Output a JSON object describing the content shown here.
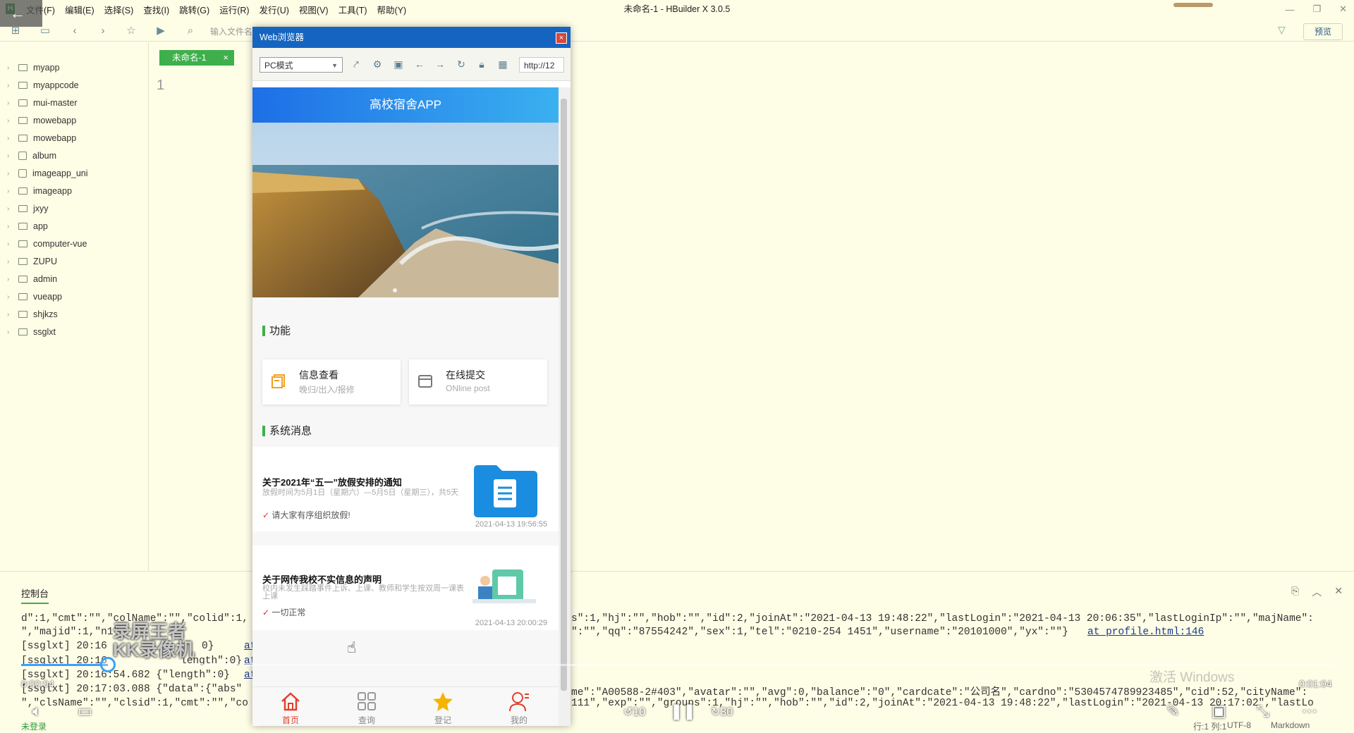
{
  "app": {
    "title": "未命名-1 - HBuilder X 3.0.5",
    "menu": [
      "文件(F)",
      "编辑(E)",
      "选择(S)",
      "查找(I)",
      "跳转(G)",
      "运行(R)",
      "发行(U)",
      "视图(V)",
      "工具(T)",
      "帮助(Y)"
    ],
    "logo_letter": "H",
    "back_arrow": "←"
  },
  "toolbar": {
    "file_input_placeholder": "输入文件名",
    "preview_label": "预览"
  },
  "sidebar": {
    "projects": [
      "myapp",
      "myappcode",
      "mui-master",
      "mowebapp",
      "mowebapp",
      "album",
      "imageapp_uni",
      "imageapp",
      "jxyy",
      "app",
      "computer-vue",
      "ZUPU",
      "admin",
      "vueapp",
      "shjkzs",
      "ssglxt"
    ]
  },
  "editor": {
    "tab_label": "未命名-1",
    "tab_close": "×",
    "line_number": "1"
  },
  "console": {
    "tab_label": "控制台",
    "lines": [
      "d\":1,\"cmt\":\"\",\"colName\":\"\",\"colid\":1,",
      "\",\"majid\":1,\"n1\"",
      "[ssglxt] 20:16",
      "[ssglxt] 20:16",
      "[ssglxt] 20:16:54.682 {\"length\":0}",
      "[ssglxt] 20:17:03.088 {\"data\":{\"abs\"",
      "\",\"clsName\":\"\",\"clsid\":1,\"cmt\":\"\",\"co"
    ],
    "lines_right": [
      "s\":1,\"hj\":\"\",\"hob\":\"\",\"id\":2,\"joinAt\":\"2021-04-13 19:48:22\",\"lastLogin\":\"2021-04-13 20:06:35\",\"lastLoginIp\":\"\",\"majName\":",
      "\":\"\",\"qq\":\"87554242\",\"sex\":1,\"tel\":\"0210-254 1451\",\"username\":\"20101000\",\"yx\":\"\"}",
      "me\":\"A00588-2#403\",\"avatar\":\"\",\"avg\":0,\"balance\":\"0\",\"cardcate\":\"公司名\",\"cardno\":\"5304574789923485\",\"cid\":52,\"cityName\":",
      "111\",\"exp\":\"\",\"groups\":1,\"hj\":\"\",\"hob\":\"\",\"id\":2,\"joinAt\":\"2021-04-13 19:48:22\",\"lastLogin\":\"2021-04-13 20:17:02\",\"lastLo"
    ],
    "link": "at profile.html:146",
    "json_fragments": [
      "length\":0}",
      "0}"
    ],
    "at_fragments": [
      "at",
      "at",
      "at",
      "at"
    ]
  },
  "statusbar": {
    "login": "未登录",
    "position": "行:1  列:1",
    "encoding": "UTF-8",
    "language": "Markdown"
  },
  "browser": {
    "title": "Web浏览器",
    "close": "×",
    "mode": "PC模式",
    "url": "http://12",
    "page": {
      "header": "高校宿舍APP",
      "func_title": "功能",
      "funcs": [
        {
          "title": "信息查看",
          "sub": "晚归/出入/报修"
        },
        {
          "title": "在线提交",
          "sub": "ONline post"
        }
      ],
      "msg_title": "系统消息",
      "messages": [
        {
          "title": "关于2021年“五一”放假安排的通知",
          "desc": "放假时间为5月1日（星期六）—5月5日（星期三），共5天",
          "note": "请大家有序组织放假!",
          "date": "2021-04-13 19:56:55"
        },
        {
          "title": "关于网传我校不实信息的声明",
          "desc": "校内未发生踩踏事件上诉、上课、教师和学生按双周一课表上课",
          "note": "一切正常",
          "date": "2021-04-13 20:00:29"
        }
      ],
      "tabs": [
        "首页",
        "查询",
        "登记",
        "我的"
      ]
    }
  },
  "video": {
    "current_time": "0:00:04",
    "total_time": "0:01:04",
    "progress": 0.066,
    "rewind_label": "10",
    "forward_label": "30",
    "watermark_text": "激活 Windows",
    "logo_text": "录屏王者 KK录像机"
  },
  "colors": {
    "accent_green": "#3db04b",
    "browser_blue": "#1565c0",
    "ide_bg": "#fefde6",
    "progress_blue": "#3aa0ff"
  }
}
